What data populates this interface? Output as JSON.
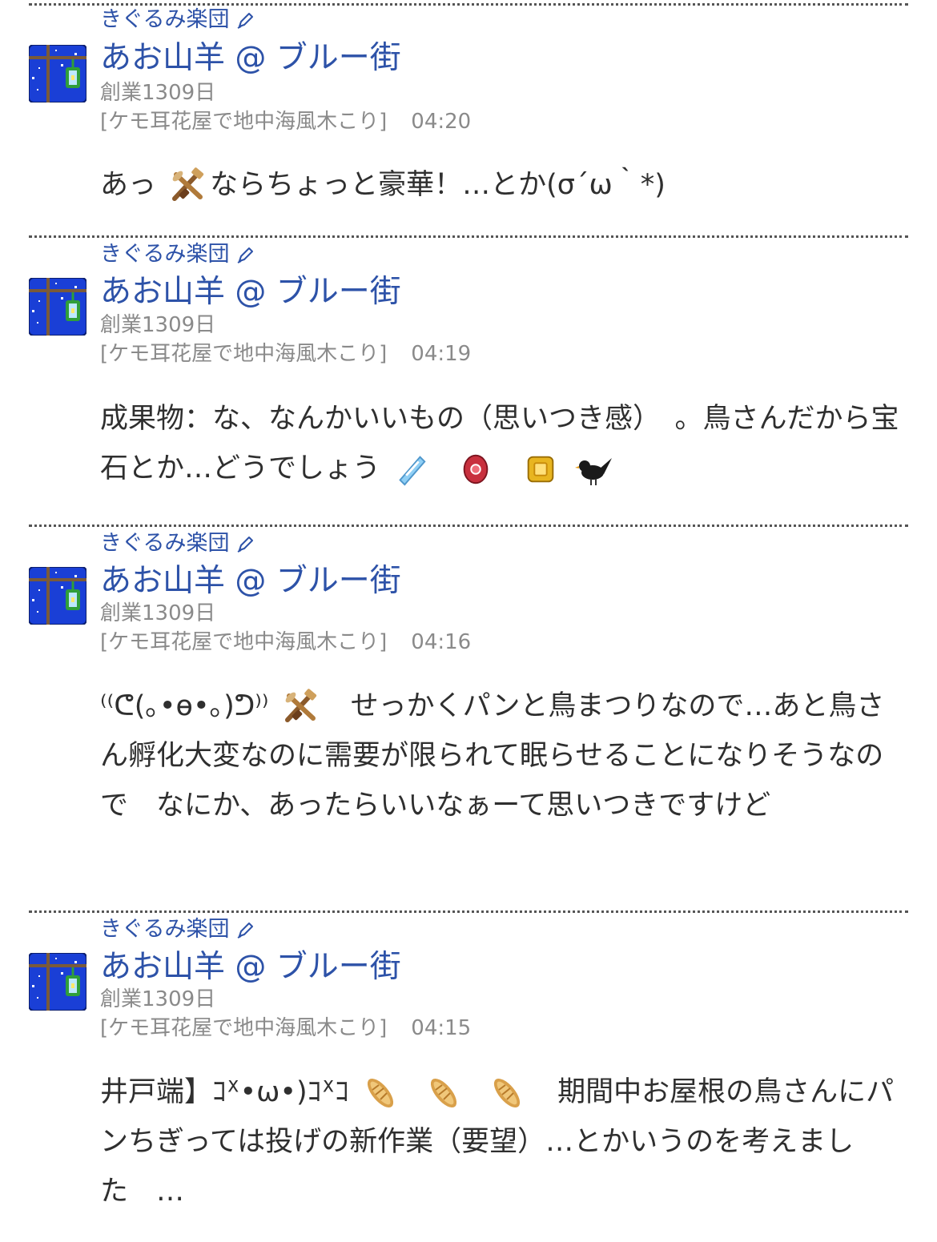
{
  "posts": [
    {
      "team": "きぐるみ楽団",
      "name": "あお山羊 @ ブルー街",
      "days": "創業1309日",
      "location": "[ケモ耳花屋で地中海風木こり]",
      "time": "04:20",
      "message": [
        "あっ",
        "ならちょっと豪華！…とか(σ´ω｀*)"
      ]
    },
    {
      "team": "きぐるみ楽団",
      "name": "あお山羊 @ ブルー街",
      "days": "創業1309日",
      "location": "[ケモ耳花屋で地中海風木こり]",
      "time": "04:19",
      "message": [
        "成果物：な、なんかいいもの（思いつき感）　。鳥さんだから宝石とか…どうでしょう"
      ]
    },
    {
      "team": "きぐるみ楽団",
      "name": "あお山羊 @ ブルー街",
      "days": "創業1309日",
      "location": "[ケモ耳花屋で地中海風木こり]",
      "time": "04:16",
      "message": [
        "⁽⁽ᕦ(｡•ɵ•｡)ᕤ⁾⁾",
        "　せっかくパンと鳥まつりなので…あと鳥さん孵化大変なのに需要が限られて眠らせることになりそうなので　なにか、あったらいいなぁーて思いつきですけど"
      ]
    },
    {
      "team": "きぐるみ楽団",
      "name": "あお山羊 @ ブルー街",
      "days": "創業1309日",
      "location": "[ケモ耳花屋で地中海風木こり]",
      "time": "04:15",
      "message": [
        "井戸端】ｺᕽ•ω•)ｺᕽｺ",
        "　期間中お屋根の鳥さんにパンちぎっては投げの新作業（要望）…とかいうのを考えました　…"
      ]
    }
  ],
  "icons": {
    "team_icon": "pen-icon",
    "avatar": "night-window-lantern-avatar",
    "emoji_tools": "crossed-tools-icon",
    "emoji_gems": [
      "diamond-icon",
      "ruby-icon",
      "topaz-icon",
      "black-bird-icon"
    ],
    "emoji_bread": "bread-icon"
  },
  "colors": {
    "name": "#2d52a8",
    "meta": "#8a8a8a",
    "text": "#2f2f2f",
    "avatar_bg": "#1a3fd6"
  }
}
